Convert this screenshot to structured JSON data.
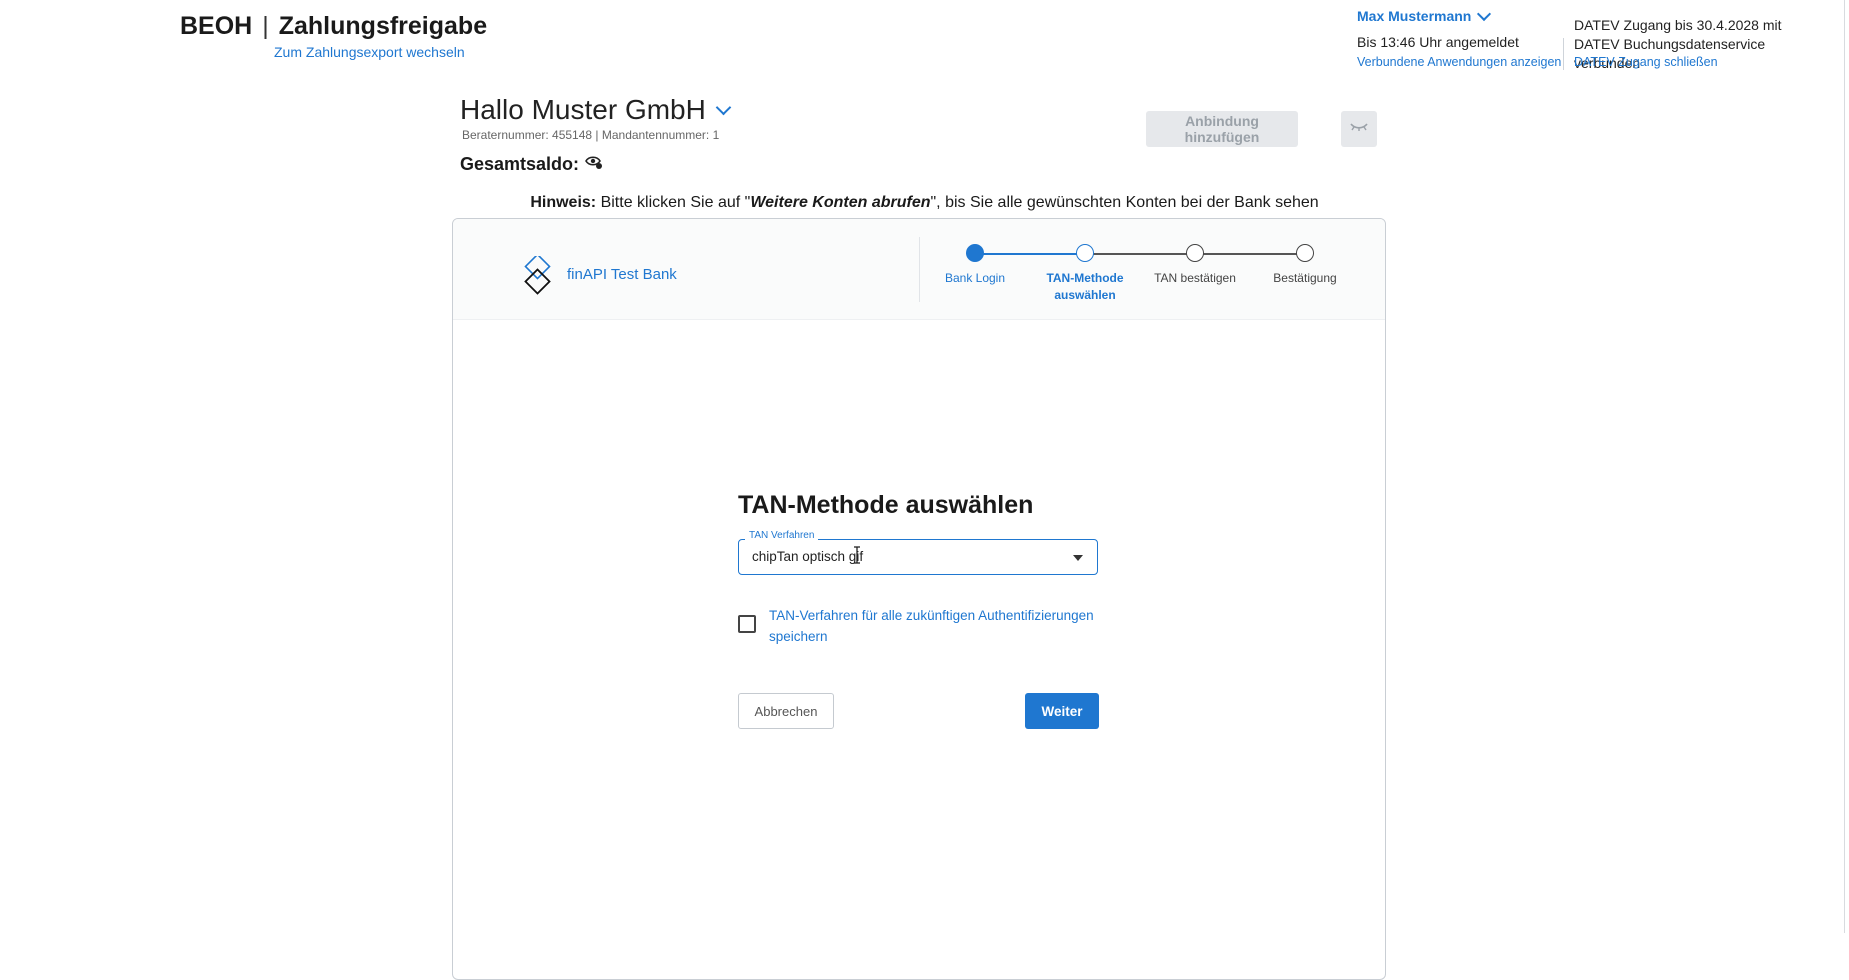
{
  "header": {
    "brand": "BEOH",
    "app_name": "Zahlungsfreigabe",
    "switch_link": "Zum Zahlungsexport wechseln",
    "user_name": "Max Mustermann",
    "login_status": "Bis 13:46 Uhr angemeldet",
    "connected_apps_link": "Verbundene Anwendungen anzeigen",
    "datev_status": "DATEV Zugang bis 30.4.2028 mit DATEV Buchungsdatenservice verbunden",
    "datev_close_link": "DATEV Zugang schließen"
  },
  "company": {
    "greeting": "Hallo Muster GmbH",
    "meta": "Beraternummer: 455148 | Mandantennummer: 1",
    "total_balance_label": "Gesamtsaldo:",
    "add_connection_button": "Anbindung hinzufügen"
  },
  "hint": {
    "label": "Hinweis:",
    "text_before": " Bitte klicken Sie auf \"",
    "emphasis": "Weitere Konten abrufen",
    "text_after": "\", bis Sie alle gewünschten Konten bei der Bank sehen"
  },
  "bank": {
    "name": "finAPI Test Bank"
  },
  "stepper": {
    "steps": [
      {
        "label_line1": "Bank Login",
        "label_line2": "",
        "state": "done"
      },
      {
        "label_line1": "TAN-Methode",
        "label_line2": "auswählen",
        "state": "current"
      },
      {
        "label_line1": "TAN bestätigen",
        "label_line2": "",
        "state": "todo"
      },
      {
        "label_line1": "Bestätigung",
        "label_line2": "",
        "state": "todo"
      }
    ]
  },
  "form": {
    "title": "TAN-Methode auswählen",
    "select_label": "TAN Verfahren",
    "select_value": "chipTan optisch gif",
    "checkbox_label": "TAN-Verfahren für alle zukünftigen Authentifizierungen speichern",
    "checkbox_checked": false,
    "cancel_button": "Abbrechen",
    "next_button": "Weiter"
  },
  "colors": {
    "accent": "#1f77d0",
    "disabled_bg": "#e6e8eb",
    "disabled_text": "#9aa1a8"
  }
}
